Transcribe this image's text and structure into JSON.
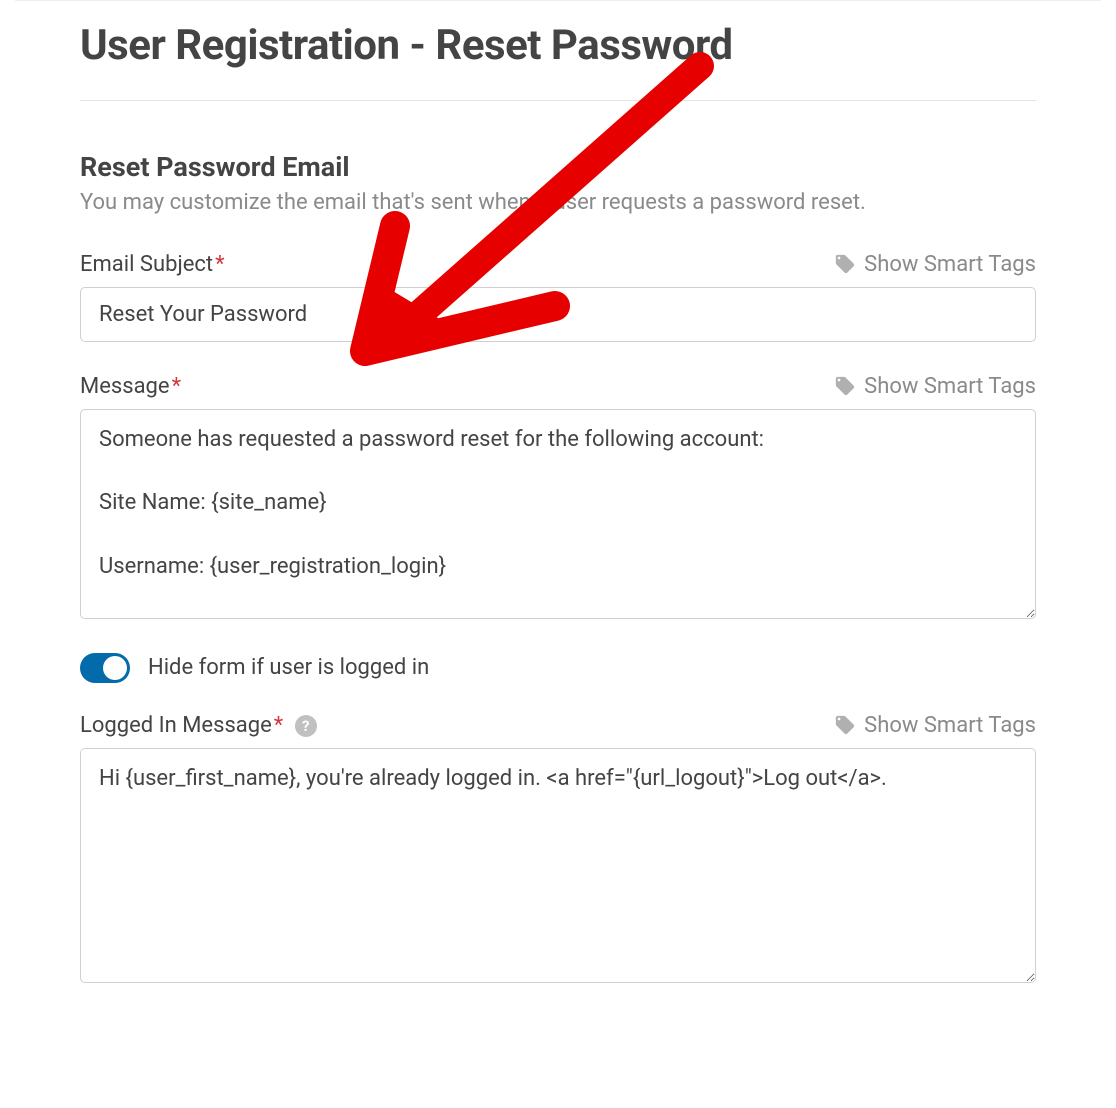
{
  "pageTitle": "User Registration - Reset Password",
  "section": {
    "heading": "Reset Password Email",
    "description": "You may customize the email that's sent when a user requests a password reset."
  },
  "smartTagsLabel": "Show Smart Tags",
  "emailSubject": {
    "label": "Email Subject",
    "value": "Reset Your Password"
  },
  "message": {
    "label": "Message",
    "value": "Someone has requested a password reset for the following account:\n\nSite Name: {site_name}\n\nUsername: {user_registration_login}"
  },
  "hideToggle": {
    "label": "Hide form if user is logged in",
    "on": true
  },
  "loggedInMessage": {
    "label": "Logged In Message",
    "value": "Hi {user_first_name}, you're already logged in. <a href=\"{url_logout}\">Log out</a>."
  }
}
